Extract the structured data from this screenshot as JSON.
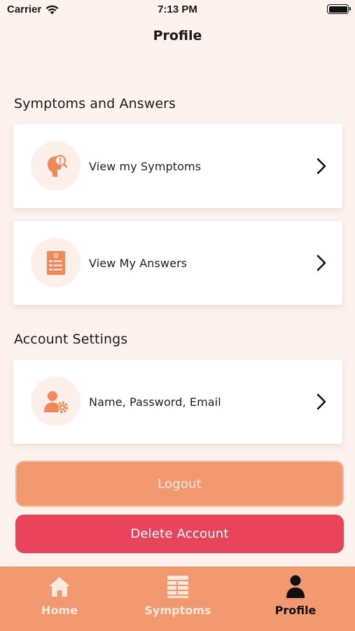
{
  "status_bar": {
    "carrier": "Carrier",
    "time": "7:13 PM"
  },
  "header": {
    "title": "Profile"
  },
  "sections": {
    "symptoms_answers": {
      "heading": "Symptoms and Answers",
      "items": [
        {
          "label": "View my Symptoms",
          "icon": "head-question-icon"
        },
        {
          "label": "View My Answers",
          "icon": "report-sheet-icon"
        }
      ]
    },
    "account_settings": {
      "heading": "Account Settings",
      "items": [
        {
          "label": "Name, Password, Email",
          "icon": "user-settings-icon"
        }
      ]
    }
  },
  "buttons": {
    "logout": "Logout",
    "delete": "Delete Account"
  },
  "tabs": [
    {
      "label": "Home",
      "icon": "home-icon",
      "active": false
    },
    {
      "label": "Symptoms",
      "icon": "symptoms-list-icon",
      "active": false
    },
    {
      "label": "Profile",
      "icon": "person-icon",
      "active": true
    }
  ],
  "colors": {
    "background": "#fdf2ee",
    "accent": "#f2996f",
    "danger": "#e9445c",
    "icon_orange": "#f2875a"
  }
}
